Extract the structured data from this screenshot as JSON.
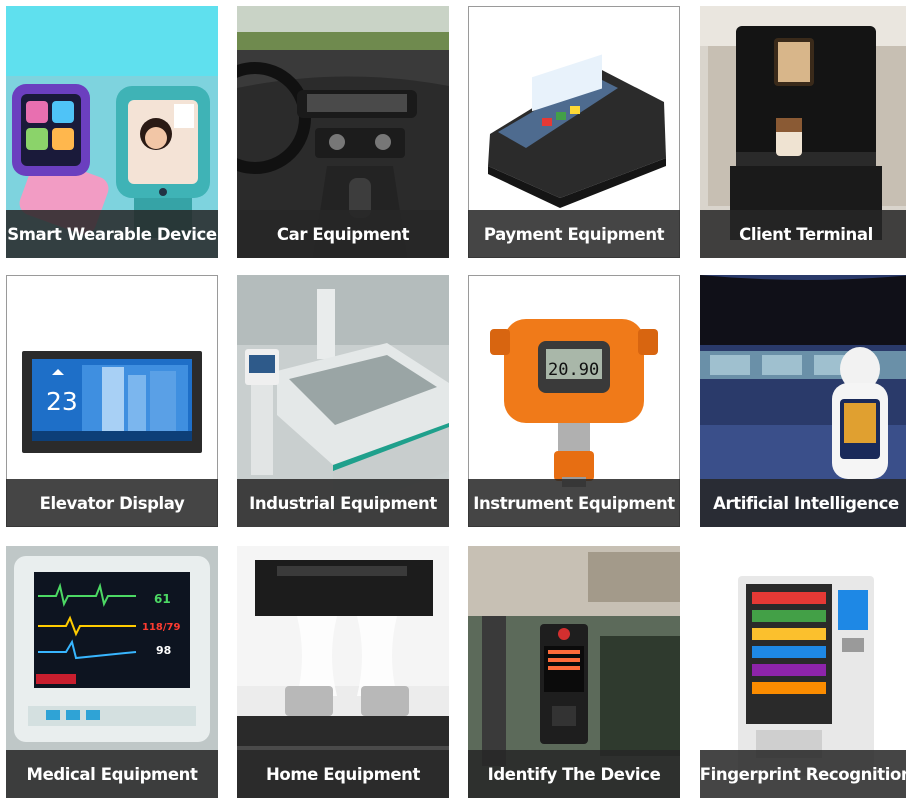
{
  "tiles": [
    {
      "label": "Smart Wearable Device",
      "icon": "smartwatch-icon"
    },
    {
      "label": "Car Equipment",
      "icon": "car-dashboard-icon"
    },
    {
      "label": "Payment Equipment",
      "icon": "pos-terminal-icon"
    },
    {
      "label": "Client Terminal",
      "icon": "coffee-machine-icon"
    },
    {
      "label": "Elevator Display",
      "icon": "elevator-display-icon"
    },
    {
      "label": "Industrial Equipment",
      "icon": "cnc-machine-icon"
    },
    {
      "label": "Instrument Equipment",
      "icon": "gas-detector-icon"
    },
    {
      "label": "Artificial Intelligence",
      "icon": "robot-icon"
    },
    {
      "label": "Medical Equipment",
      "icon": "patient-monitor-icon"
    },
    {
      "label": "Home Equipment",
      "icon": "range-hood-icon"
    },
    {
      "label": "Identify The Device",
      "icon": "access-control-icon"
    },
    {
      "label": "Fingerprint Recognition",
      "icon": "vending-machine-icon"
    }
  ],
  "screen_text": {
    "elevator_floor": "23",
    "gas_reading": "20.90",
    "monitor_hr": "61",
    "monitor_bp": "118/79",
    "monitor_spo2": "98"
  },
  "colors": {
    "caption_bg": "#262626",
    "caption_text": "#ffffff",
    "wearable_bg": "#5fe0ee",
    "elevator_blue": "#1e6fc8",
    "detector_orange": "#f07a19"
  }
}
